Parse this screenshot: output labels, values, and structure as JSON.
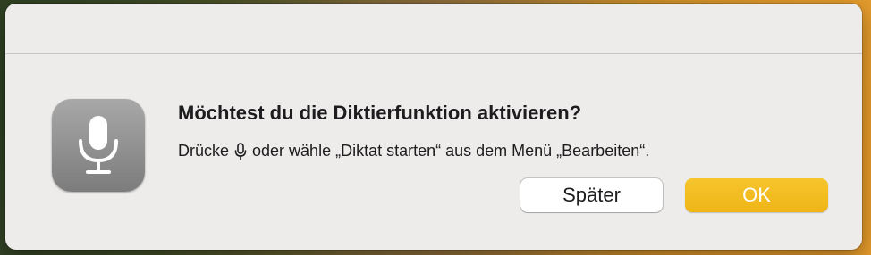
{
  "dialog": {
    "title": "Möchtest du die Diktierfunktion aktivieren?",
    "message_before": "Drücke",
    "message_after": "oder wähle „Diktat starten“ aus dem Menü „Bearbeiten“.",
    "inline_icon": "microphone-icon",
    "app_icon": "dictation-microphone-icon"
  },
  "buttons": {
    "later_label": "Später",
    "ok_label": "OK"
  },
  "colors": {
    "accent": "#f0b81c",
    "dialog_background": "#eeeceb",
    "text": "#1d1d1f"
  }
}
